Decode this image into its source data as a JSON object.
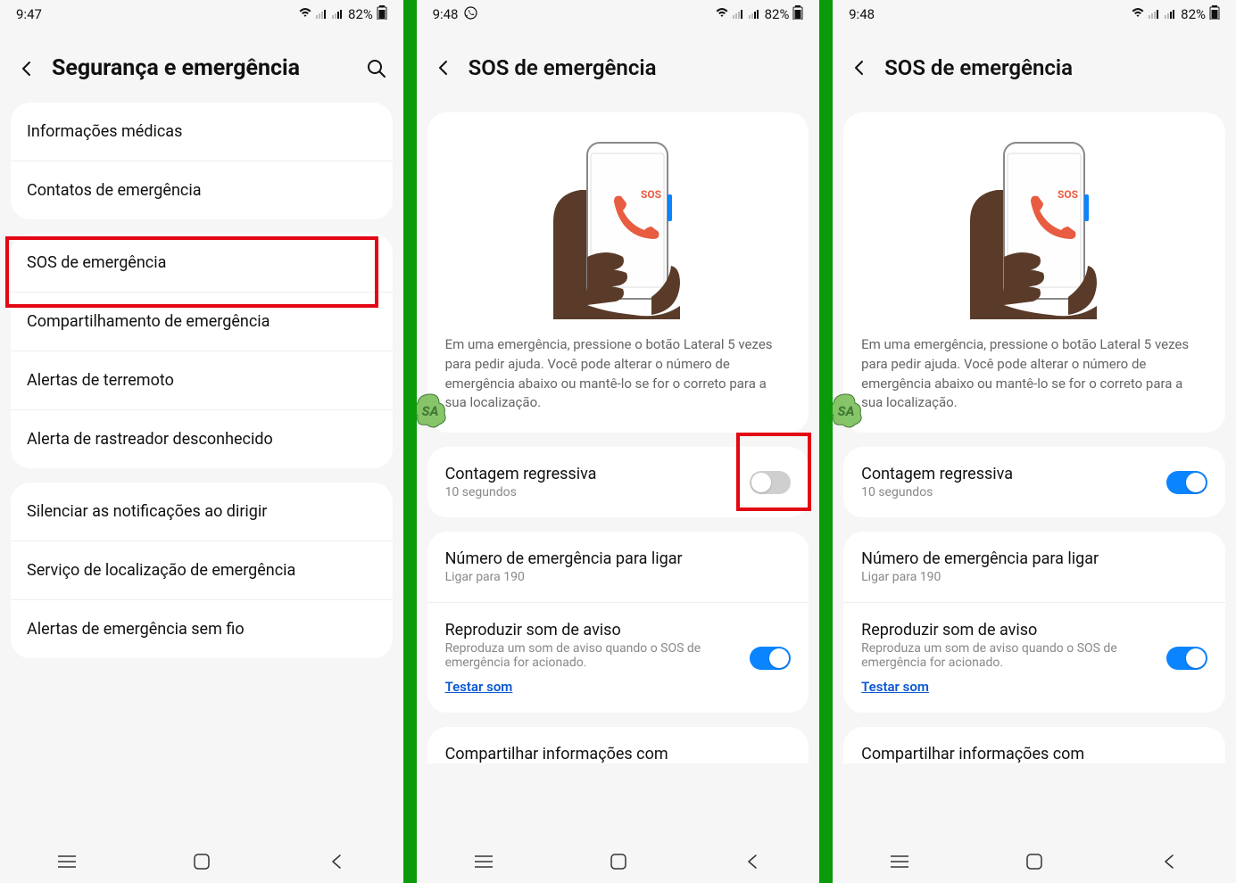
{
  "status": {
    "battery_pct": "82%",
    "time_a": "9:47",
    "time_b": "9:48",
    "time_c": "9:48"
  },
  "screen1": {
    "title": "Segurança e emergência",
    "items_group1": [
      "Informações médicas",
      "Contatos de emergência"
    ],
    "items_group2": [
      "SOS de emergência",
      "Compartilhamento de emergência",
      "Alertas de terremoto",
      "Alerta de rastreador desconhecido"
    ],
    "items_group3": [
      "Silenciar as notificações ao dirigir",
      "Serviço de localização de emergência",
      "Alertas de emergência sem fio"
    ]
  },
  "screen2": {
    "title": "SOS de emergência",
    "description": "Em uma emergência, pressione o botão Lateral 5 vezes para pedir ajuda. Você pode alterar o número de emergência abaixo ou mantê-lo se for o correto para a sua localização.",
    "countdown_title": "Contagem regressiva",
    "countdown_sub": "10 segundos",
    "number_title": "Número de emergência para ligar",
    "number_sub": "Ligar para 190",
    "sound_title": "Reproduzir som de aviso",
    "sound_sub": "Reproduza um som de aviso quando o SOS de emergência for acionado.",
    "sound_link": "Testar som",
    "share_title": "Compartilhar informações com"
  },
  "icons": {
    "sos_label": "SOS"
  },
  "colors": {
    "highlight_red": "#e30613",
    "frame_green": "#0a9a0a",
    "toggle_on": "#0b84ff",
    "link": "#0b57d0"
  }
}
